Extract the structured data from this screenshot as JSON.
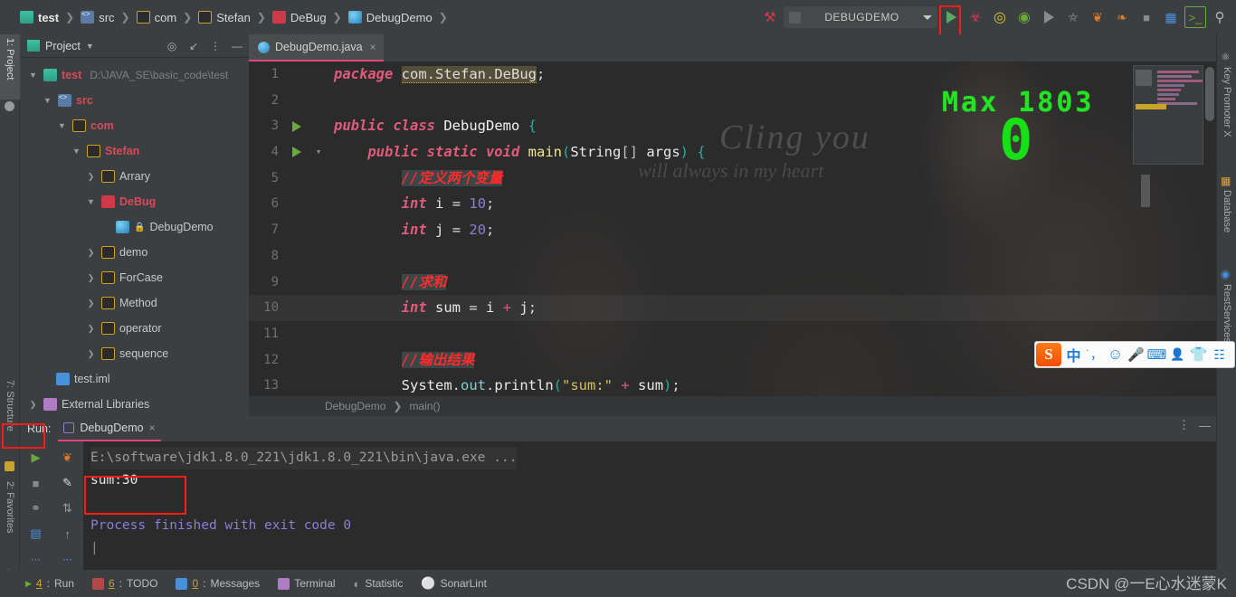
{
  "breadcrumb": [
    {
      "label": "test",
      "icon": "module-icon",
      "bold": true
    },
    {
      "label": "src",
      "icon": "source-root-icon",
      "bold": false
    },
    {
      "label": "com",
      "icon": "package-icon",
      "bold": false
    },
    {
      "label": "Stefan",
      "icon": "package-icon",
      "bold": false
    },
    {
      "label": "DeBug",
      "icon": "package-red-icon",
      "bold": false
    },
    {
      "label": "DebugDemo",
      "icon": "class-icon",
      "bold": false
    }
  ],
  "toolbar": {
    "run_config": "DEBUGDEMO",
    "buttons": [
      {
        "name": "build-icon",
        "glyph": "⚒"
      },
      {
        "name": "run-button",
        "glyph": "▶"
      },
      {
        "name": "debug-button",
        "glyph": "⚙"
      },
      {
        "name": "run-coverage-button",
        "glyph": "◎"
      },
      {
        "name": "profiler-button",
        "glyph": "◔"
      },
      {
        "name": "run-grey-button",
        "glyph": "▶"
      },
      {
        "name": "attach-button",
        "glyph": "◑"
      },
      {
        "name": "rerun-tests-button",
        "glyph": "❦"
      },
      {
        "name": "coverage-tests-button",
        "glyph": "❧"
      },
      {
        "name": "stop-button",
        "glyph": "■"
      },
      {
        "name": "layout-button",
        "glyph": "░"
      },
      {
        "name": "terminal-button",
        "glyph": "⬛"
      },
      {
        "name": "search-everywhere-icon",
        "glyph": "⌕"
      }
    ]
  },
  "left_strip": [
    {
      "label": "1: Project",
      "selected": true
    },
    {
      "label": "7: Structure",
      "selected": false
    },
    {
      "label": "2: Favorites",
      "selected": false
    }
  ],
  "right_strip": [
    {
      "label": "Key Promoter X"
    },
    {
      "label": "Database"
    },
    {
      "label": "RestServices"
    }
  ],
  "project_panel": {
    "title": "Project",
    "header_icons": [
      "target-icon",
      "collapse-all-icon",
      "more-options-icon",
      "hide-panel-icon"
    ],
    "tree": [
      {
        "depth": 0,
        "arrow": "v",
        "icon": "module-icon",
        "label": "test",
        "red": true,
        "path": "D:\\JAVA_SE\\basic_code\\test"
      },
      {
        "depth": 1,
        "arrow": "v",
        "icon": "source-root-icon",
        "label": "src",
        "red": true,
        "path": ""
      },
      {
        "depth": 2,
        "arrow": "v",
        "icon": "package-icon",
        "label": "com",
        "red": true,
        "path": ""
      },
      {
        "depth": 3,
        "arrow": "v",
        "icon": "package-icon",
        "label": "Stefan",
        "red": true,
        "path": ""
      },
      {
        "depth": 4,
        "arrow": ">",
        "icon": "package-yellow-icon",
        "label": "Arrary",
        "red": false,
        "path": ""
      },
      {
        "depth": 4,
        "arrow": "v",
        "icon": "package-red-icon",
        "label": "DeBug",
        "red": true,
        "path": ""
      },
      {
        "depth": 5,
        "arrow": "",
        "icon": "class-icon",
        "label": "DebugDemo",
        "red": false,
        "path": "",
        "lock": true
      },
      {
        "depth": 4,
        "arrow": ">",
        "icon": "package-yellow-icon",
        "label": "demo",
        "red": false,
        "path": ""
      },
      {
        "depth": 4,
        "arrow": ">",
        "icon": "package-yellow-icon",
        "label": "ForCase",
        "red": false,
        "path": ""
      },
      {
        "depth": 4,
        "arrow": ">",
        "icon": "package-yellow-icon",
        "label": "Method",
        "red": false,
        "path": ""
      },
      {
        "depth": 4,
        "arrow": ">",
        "icon": "package-yellow-icon",
        "label": "operator",
        "red": false,
        "path": ""
      },
      {
        "depth": 4,
        "arrow": ">",
        "icon": "package-yellow-icon",
        "label": "sequence",
        "red": false,
        "path": ""
      },
      {
        "depth": 1,
        "arrow": "",
        "icon": "iml-icon",
        "label": "test.iml",
        "red": false,
        "path": ""
      },
      {
        "depth": 0,
        "arrow": ">",
        "icon": "library-icon",
        "label": "External Libraries",
        "red": false,
        "path": ""
      }
    ]
  },
  "editor": {
    "tab": {
      "label": "DebugDemo.java",
      "icon": "java-class-icon",
      "close": "×"
    },
    "breadcrumb": [
      "DebugDemo",
      "main()"
    ],
    "bg_text_1": "Cling you",
    "bg_text_2": "will always in my heart",
    "lines": [
      {
        "n": "1",
        "gutter": "",
        "fold": false,
        "hl": false
      },
      {
        "n": "2",
        "gutter": "",
        "fold": false,
        "hl": false
      },
      {
        "n": "3",
        "gutter": "run",
        "fold": false,
        "hl": false
      },
      {
        "n": "4",
        "gutter": "run",
        "fold": true,
        "hl": false
      },
      {
        "n": "5",
        "gutter": "",
        "fold": false,
        "hl": false
      },
      {
        "n": "6",
        "gutter": "",
        "fold": false,
        "hl": false
      },
      {
        "n": "7",
        "gutter": "",
        "fold": false,
        "hl": false
      },
      {
        "n": "8",
        "gutter": "",
        "fold": false,
        "hl": false
      },
      {
        "n": "9",
        "gutter": "",
        "fold": false,
        "hl": false
      },
      {
        "n": "10",
        "gutter": "",
        "fold": false,
        "hl": true
      },
      {
        "n": "11",
        "gutter": "",
        "fold": false,
        "hl": false
      },
      {
        "n": "12",
        "gutter": "",
        "fold": false,
        "hl": false
      },
      {
        "n": "13",
        "gutter": "",
        "fold": false,
        "hl": false
      }
    ],
    "code": {
      "l1_kw": "package",
      "l1_pkg": "com.Stefan.DeBug",
      "l1_semi": ";",
      "l3_kw": "public class",
      "l3_name": "DebugDemo",
      "l3_brace": "{",
      "l4_kw": "public static void",
      "l4_name": "main",
      "l4_p1": "(",
      "l4_type": "String",
      "l4_brackets": "[]",
      "l4_arg": "args",
      "l4_p2": ")",
      "l4_brace": "{",
      "l5_cmt": "//定义两个变量",
      "l6_kw": "int",
      "l6_var": "i",
      "l6_eq": "=",
      "l6_num": "10",
      "l6_semi": ";",
      "l7_kw": "int",
      "l7_var": "j",
      "l7_eq": "=",
      "l7_num": "20",
      "l7_semi": ";",
      "l9_cmt": "//求和",
      "l10_kw": "int",
      "l10_var": "sum",
      "l10_eq": "=",
      "l10_a": "i",
      "l10_plus": "+",
      "l10_b": "j",
      "l10_semi": ";",
      "l12_cmt": "//输出结果",
      "l13_sys": "System",
      "l13_dot1": ".",
      "l13_out": "out",
      "l13_dot2": ".",
      "l13_println": "println",
      "l13_p1": "(",
      "l13_str": "\"sum:\"",
      "l13_plus": "+",
      "l13_sum": "sum",
      "l13_p2": ")",
      "l13_semi": ";"
    }
  },
  "overlay": {
    "max_label": "Max  1803",
    "value": "0",
    "color": "#17e017"
  },
  "ime": {
    "logo": "S",
    "icons": [
      "中",
      "˙，",
      "☺",
      "♉",
      "⌨",
      "☰",
      "♣",
      "☷"
    ]
  },
  "run_panel": {
    "label": "Run:",
    "tab": {
      "label": "DebugDemo",
      "close": "×"
    },
    "side_buttons": [
      {
        "name": "rerun-button",
        "glyph": "▶"
      },
      {
        "name": "rerun-failed-button",
        "glyph": "❦"
      },
      {
        "name": "stop-button",
        "glyph": "■"
      },
      {
        "name": "edit-config-button",
        "glyph": "✎"
      },
      {
        "name": "attach-button",
        "glyph": "⑂"
      },
      {
        "name": "sort-button",
        "glyph": "⇅"
      },
      {
        "name": "print-button",
        "glyph": "▤"
      },
      {
        "name": "scroll-up-button",
        "glyph": "↑"
      },
      {
        "name": "more-left-button",
        "glyph": "⋯"
      },
      {
        "name": "more-right-button",
        "glyph": "⋯"
      }
    ],
    "header_right": [
      {
        "name": "more-options-icon",
        "glyph": "⋮"
      },
      {
        "name": "hide-panel-icon",
        "glyph": "—"
      }
    ],
    "console": {
      "command": "E:\\software\\jdk1.8.0_221\\jdk1.8.0_221\\bin\\java.exe ...",
      "output": "sum:30",
      "finish": "Process finished with exit code 0"
    }
  },
  "status_bar": {
    "items": [
      {
        "num": "4",
        "label": "Run",
        "icon": "run-icon",
        "accent": "#59a869"
      },
      {
        "num": "6",
        "label": "TODO",
        "icon": "todo-icon",
        "accent": "#c9a227"
      },
      {
        "num": "0",
        "label": "Messages",
        "icon": "messages-icon",
        "accent": "#4a90d9"
      },
      {
        "num": "",
        "label": "Terminal",
        "icon": "terminal-icon",
        "accent": "#b07cc6"
      },
      {
        "num": "",
        "label": "Statistic",
        "icon": "statistic-icon",
        "accent": "#9a9a9a"
      },
      {
        "num": "",
        "label": "SonarLint",
        "icon": "sonarlint-icon",
        "accent": "#d0394a"
      }
    ]
  },
  "watermark": "CSDN @一E心水迷蒙K"
}
